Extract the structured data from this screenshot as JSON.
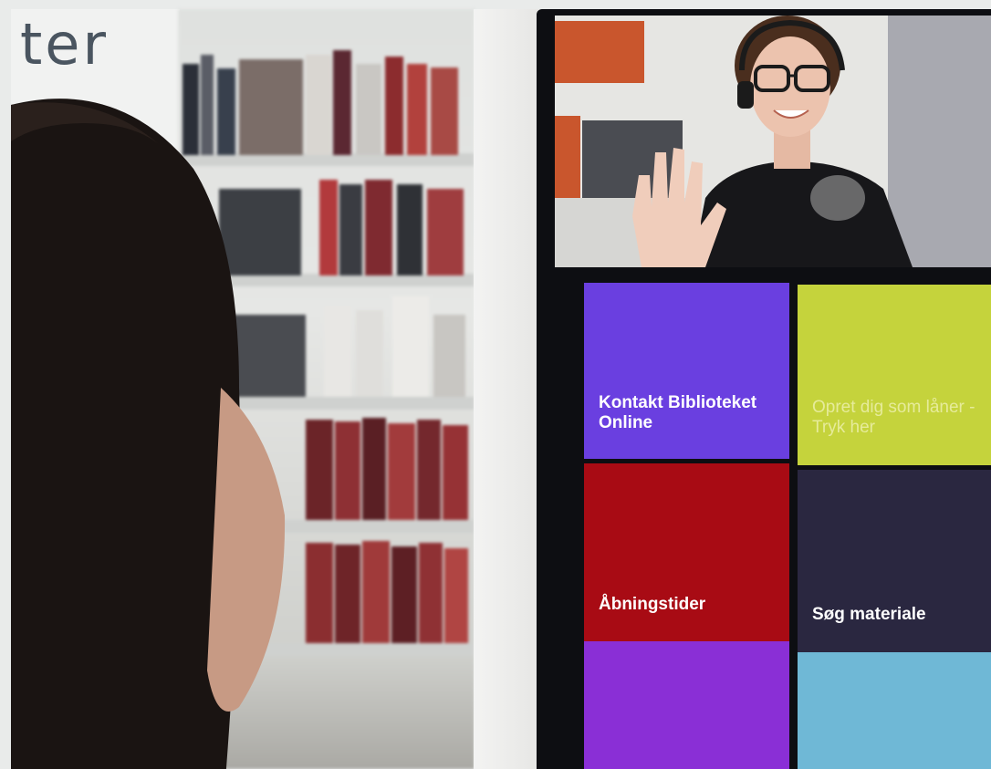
{
  "sign": {
    "text": "ter"
  },
  "kiosk": {
    "tiles": [
      {
        "label": "Kontakt Biblioteket Online",
        "color": "#6a3fe0"
      },
      {
        "label": "Opret dig som låner - Tryk her",
        "color": "#c5d33c"
      },
      {
        "label": "Åbningstider",
        "color": "#a80b14"
      },
      {
        "label": "Søg materiale",
        "color": "#2a2740"
      },
      {
        "label": "",
        "color": "#8a2fd6"
      },
      {
        "label": "",
        "color": "#6fb8d6"
      }
    ]
  }
}
